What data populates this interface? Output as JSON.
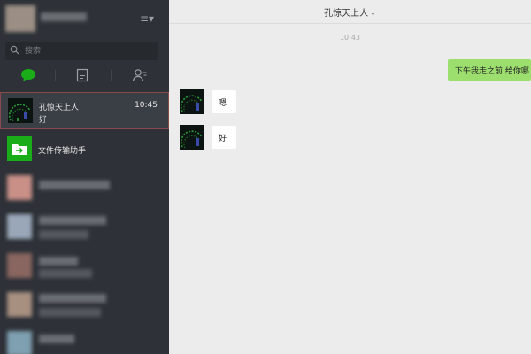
{
  "search": {
    "placeholder": "搜索"
  },
  "sidebar": {
    "tabs": [
      {
        "icon": "chat-bubble-icon",
        "color": "#1aad19"
      },
      {
        "icon": "document-icon"
      },
      {
        "icon": "contacts-icon"
      }
    ]
  },
  "chats": [
    {
      "name": "孔惊天上人",
      "time": "10:45",
      "last_message": "好",
      "active": true
    },
    {
      "name": "文件传输助手",
      "icon": "file-transfer-icon",
      "color": "#1aad19"
    }
  ],
  "conversation": {
    "title": "孔惊天上人",
    "time_divider": "10:43",
    "messages": [
      {
        "direction": "out",
        "text": "下午我走之前 给你哪"
      },
      {
        "direction": "in",
        "text": "嗯"
      },
      {
        "direction": "in",
        "text": "好"
      }
    ]
  },
  "colors": {
    "sidebar": "#2e3238",
    "out_bubble": "#9ddf6f",
    "accent": "#1aad19"
  }
}
